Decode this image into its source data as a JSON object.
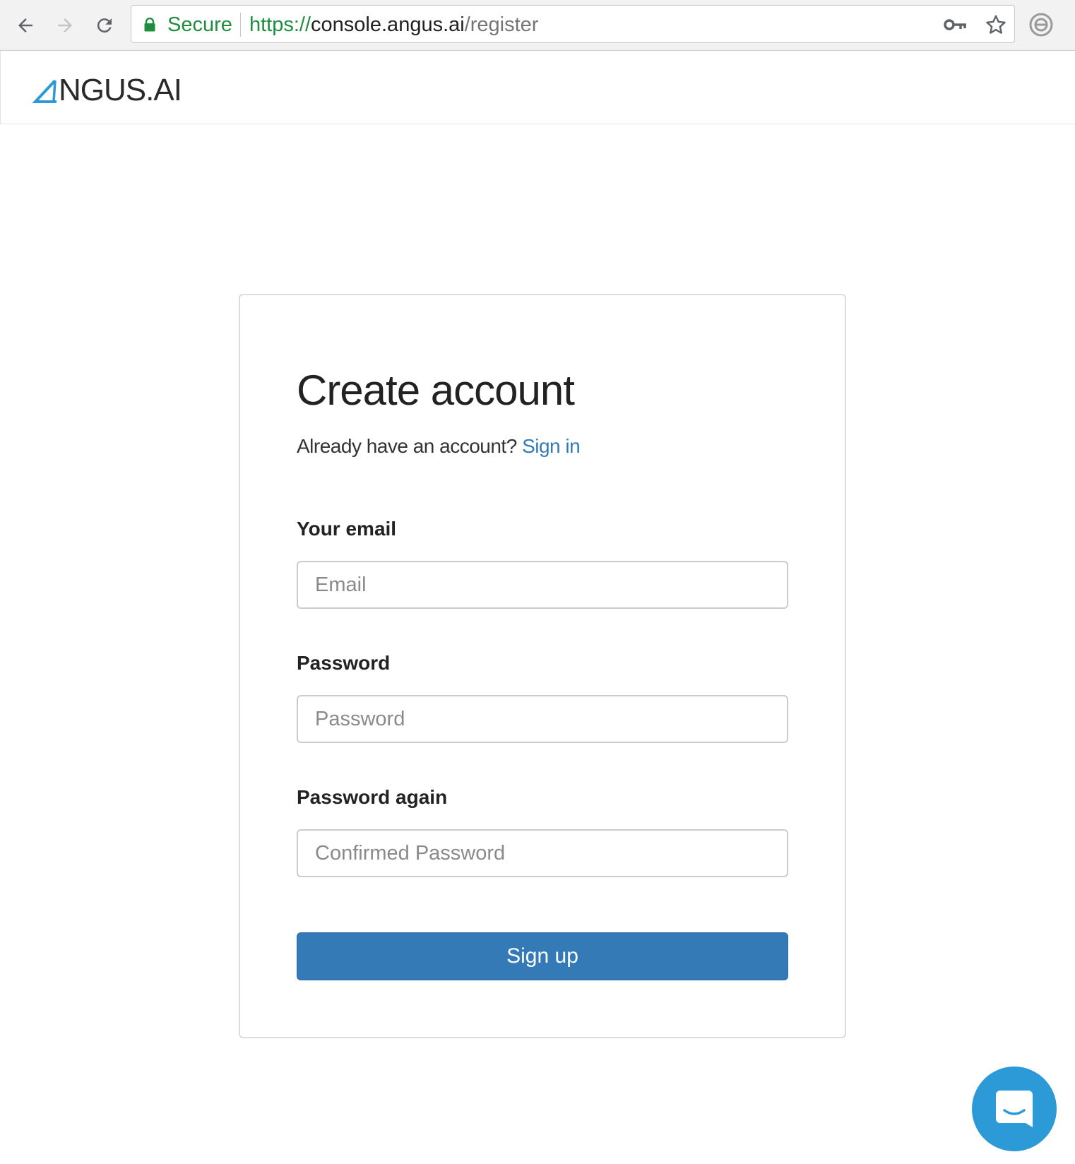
{
  "browser": {
    "secure_label": "Secure",
    "url_scheme": "https://",
    "url_host": "console.angus.ai",
    "url_path": "/register",
    "icons": [
      "back-arrow-icon",
      "forward-arrow-icon",
      "reload-icon",
      "lock-icon",
      "key-icon",
      "star-icon",
      "extension-icon"
    ]
  },
  "header": {
    "logo_text": "NGUS.AI"
  },
  "card": {
    "title": "Create account",
    "signin_prompt": "Already have an account?",
    "signin_link": "Sign in",
    "fields": {
      "email": {
        "label": "Your email",
        "placeholder": "Email",
        "value": ""
      },
      "password": {
        "label": "Password",
        "placeholder": "Password",
        "value": ""
      },
      "password_again": {
        "label": "Password again",
        "placeholder": "Confirmed Password",
        "value": ""
      }
    },
    "submit_label": "Sign up"
  },
  "chat": {
    "icon": "chat-bubble-icon"
  },
  "colors": {
    "accent": "#337ab7",
    "secure_green": "#1e8e3e",
    "chat_blue": "#2b9ad6"
  }
}
